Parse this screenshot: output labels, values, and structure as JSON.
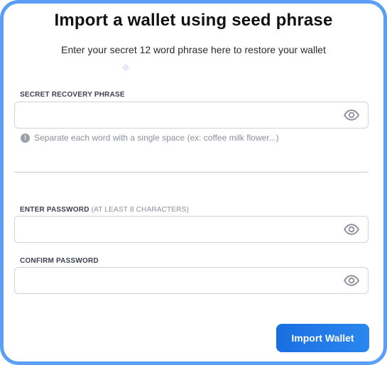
{
  "header": {
    "title": "Import a wallet using seed phrase",
    "subtitle": "Enter your secret 12 word phrase here to restore your wallet"
  },
  "recovery": {
    "label": "SECRET RECOVERY PHRASE",
    "value": "",
    "placeholder": "",
    "helper_icon": "info-icon",
    "helper_text": "Separate each word with a single space (ex: coffee milk flower...)"
  },
  "password": {
    "label": "ENTER PASSWORD",
    "hint": "(AT LEAST 8 CHARACTERS)",
    "value": "",
    "placeholder": ""
  },
  "confirm": {
    "label": "CONFIRM PASSWORD",
    "value": "",
    "placeholder": ""
  },
  "icons": {
    "visibility_toggle": "eye-icon",
    "info": "info-icon"
  },
  "actions": {
    "import_label": "Import Wallet"
  },
  "colors": {
    "frame_border": "#5b9ef5",
    "primary_button": "#1a6fe0",
    "eye_icon": "#8a8f9c"
  }
}
